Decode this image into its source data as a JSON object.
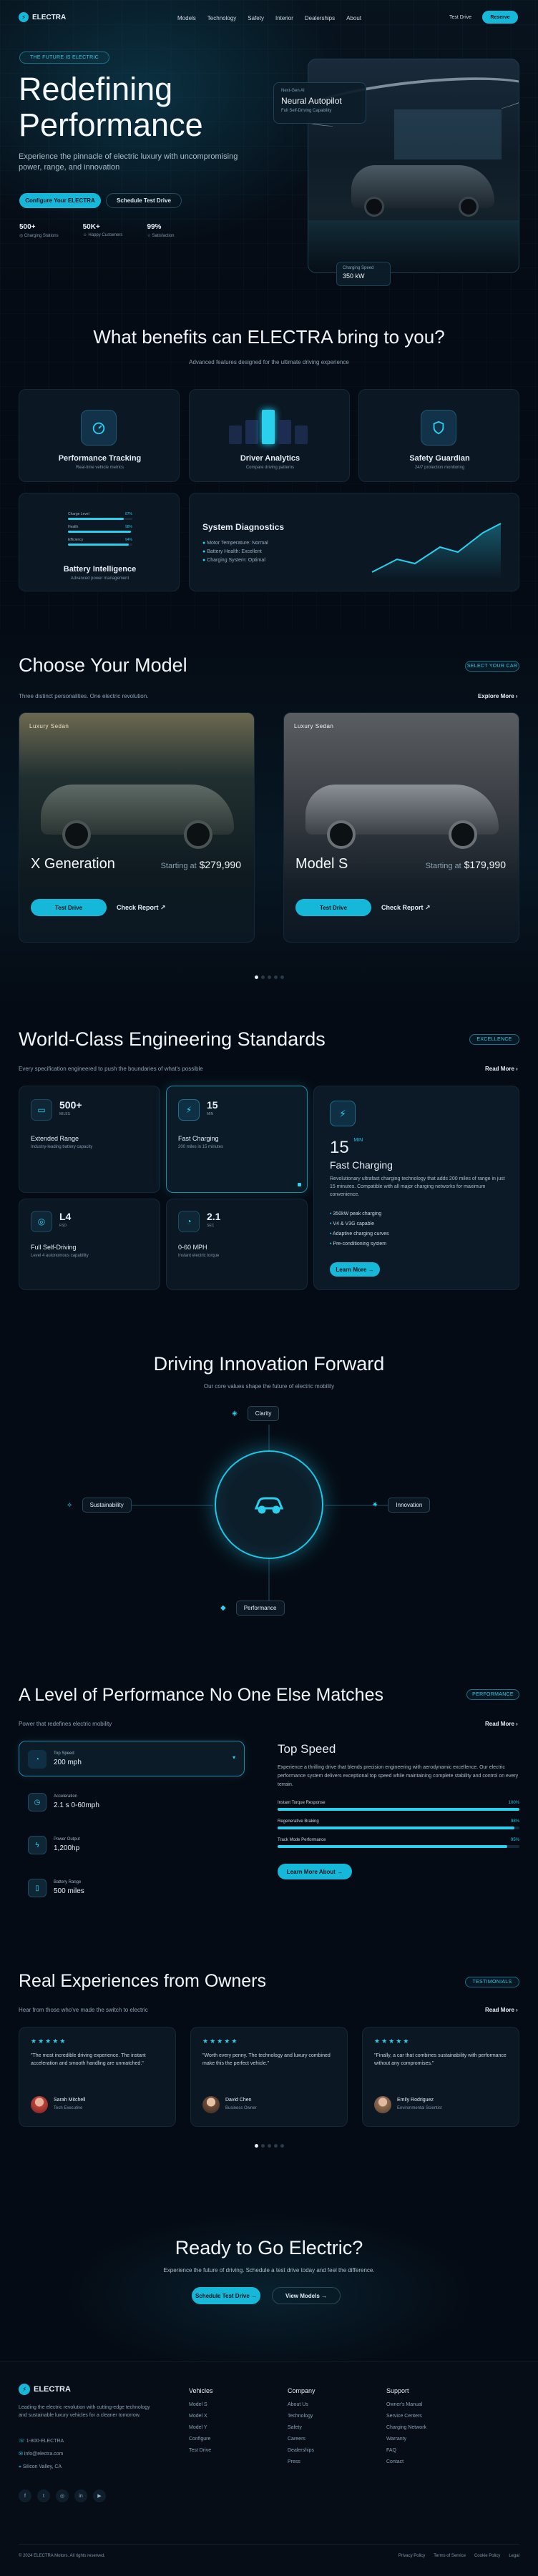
{
  "nav": {
    "brand": "ELECTRA",
    "links": [
      "Models",
      "Technology",
      "Safety",
      "Interior",
      "Dealerships",
      "About"
    ],
    "test_drive": "Test Drive",
    "reserve": "Reserve"
  },
  "hero": {
    "tag": "THE FUTURE IS ELECTRIC",
    "title1": "Redefining",
    "title2": "Performance",
    "desc": "Experience the pinnacle of electric luxury with uncompromising power, range, and innovation",
    "cta_primary": "Configure Your ELECTRA",
    "cta_secondary": "Schedule Test Drive",
    "stats": [
      {
        "value": "500+",
        "label": "Charging Stations"
      },
      {
        "value": "50K+",
        "label": "Happy Customers"
      },
      {
        "value": "99%",
        "label": "Satisfaction"
      }
    ],
    "card_small": "Next-Gen AI",
    "card_title": "Neural Autopilot",
    "card_desc": "Full Self-Driving Capability",
    "charge_label": "Charging Speed",
    "charge_value": "350 kW"
  },
  "benefits": {
    "title": "What benefits can ELECTRA bring to you?",
    "subtitle": "Advanced features designed for the ultimate driving experience",
    "cards": [
      {
        "title": "Performance Tracking",
        "desc": "Real-time vehicle metrics"
      },
      {
        "title": "Driver Analytics",
        "desc": "Compare driving patterns"
      },
      {
        "title": "Safety Guardian",
        "desc": "24/7 protection monitoring"
      }
    ],
    "battery": {
      "title": "Battery Intelligence",
      "desc": "Advanced power management",
      "bars": [
        {
          "label": "Charge Level",
          "value": "87%",
          "pct": 87
        },
        {
          "label": "Health",
          "value": "98%",
          "pct": 98
        },
        {
          "label": "Efficiency",
          "value": "94%",
          "pct": 94
        }
      ]
    },
    "diag": {
      "title": "System Diagnostics",
      "items": [
        "Motor Temperature: Normal",
        "Battery Health: Excellent",
        "Charging System: Optimal"
      ]
    }
  },
  "models": {
    "title": "Choose Your Model",
    "subtitle": "Three distinct personalities. One electric revolution.",
    "pill": "SELECT YOUR CAR",
    "explore": "Explore More",
    "cards": [
      {
        "badge": "Luxury Sedan",
        "name": "X Generation",
        "starting": "Starting at",
        "price": "$279,990",
        "test": "Test Drive",
        "report": "Check Report"
      },
      {
        "badge": "Luxury Sedan",
        "name": "Model S",
        "starting": "Starting at",
        "price": "$179,990",
        "test": "Test Drive",
        "report": "Check Report"
      }
    ]
  },
  "engineering": {
    "title": "World-Class Engineering Standards",
    "subtitle": "Every specification engineered to push the boundaries of what's possible",
    "pill": "EXCELLENCE",
    "read_more": "Read More",
    "cards": [
      {
        "value": "500+",
        "unit": "MILES",
        "title": "Extended Range",
        "desc": "Industry-leading battery capacity"
      },
      {
        "value": "15",
        "unit": "MIN",
        "title": "Fast Charging",
        "desc": "200 miles in 15 minutes"
      },
      {
        "value": "L4",
        "unit": "FSD",
        "title": "Full Self-Driving",
        "desc": "Level 4 autonomous capability"
      },
      {
        "value": "2.1",
        "unit": "SEC",
        "title": "0-60 MPH",
        "desc": "Instant electric torque"
      }
    ],
    "detail": {
      "value": "15",
      "unit": "MIN",
      "title": "Fast Charging",
      "desc": "Revolutionary ultrafast charging technology that adds 200 miles of range in just 15 minutes. Compatible with all major charging networks for maximum convenience.",
      "features": [
        "350kW peak charging",
        "V4 & V3G capable",
        "Adaptive charging curves",
        "Pre-conditioning system"
      ],
      "cta": "Learn More"
    }
  },
  "innovation": {
    "title": "Driving Innovation Forward",
    "subtitle": "Our core values shape the future of electric mobility",
    "nodes": [
      "Clarity",
      "Sustainability",
      "Innovation",
      "Performance"
    ]
  },
  "performance": {
    "title": "A Level of Performance No One Else Matches",
    "subtitle": "Power that redefines electric mobility",
    "pill": "PERFORMANCE",
    "read_more": "Read More",
    "list": [
      {
        "label": "Top Speed",
        "value": "200 mph"
      },
      {
        "label": "Acceleration",
        "value": "2.1 s 0-60mph"
      },
      {
        "label": "Power Output",
        "value": "1,200hp"
      },
      {
        "label": "Battery Range",
        "value": "500 miles"
      }
    ],
    "detail": {
      "title": "Top Speed",
      "desc": "Experience a thrilling drive that blends precision engineering with aerodynamic excellence. Our electric performance system delivers exceptional top speed while maintaining complete stability and control on every terrain.",
      "bars": [
        {
          "label": "Instant Torque Response",
          "value": "100%",
          "pct": 100
        },
        {
          "label": "Regenerative Braking",
          "value": "98%",
          "pct": 98
        },
        {
          "label": "Track Mode Performance",
          "value": "95%",
          "pct": 95
        }
      ],
      "cta": "Learn More About"
    }
  },
  "testimonials": {
    "title": "Real Experiences from Owners",
    "subtitle": "Hear from those who've made the switch to electric",
    "pill": "TESTIMONIALS",
    "items": [
      {
        "quote": "\"The most incredible driving experience. The instant acceleration and smooth handling are unmatched.\"",
        "name": "Sarah Mitchell",
        "role": "Tech Executive"
      },
      {
        "quote": "\"Worth every penny. The technology and luxury combined make this the perfect vehicle.\"",
        "name": "David Chen",
        "role": "Business Owner"
      },
      {
        "quote": "\"Finally, a car that combines sustainability with performance without any compromises.\"",
        "name": "Emily Rodriguez",
        "role": "Environmental Scientist"
      }
    ]
  },
  "cta": {
    "title": "Ready to Go Electric?",
    "desc": "Experience the future of driving. Schedule a test drive today and feel the difference.",
    "primary": "Schedule Test Drive",
    "secondary": "View Models"
  },
  "footer": {
    "brand": "ELECTRA",
    "about": "Leading the electric revolution with cutting-edge technology and sustainable luxury vehicles for a cleaner tomorrow.",
    "phone": "1-800-ELECTRA",
    "email": "info@electra.com",
    "location": "Silicon Valley, CA",
    "cols": [
      {
        "title": "Vehicles",
        "links": [
          "Model S",
          "Model X",
          "Model Y",
          "Configure",
          "Test Drive"
        ]
      },
      {
        "title": "Company",
        "links": [
          "About Us",
          "Technology",
          "Safety",
          "Careers",
          "Dealerships",
          "Press"
        ]
      },
      {
        "title": "Support",
        "links": [
          "Owner's Manual",
          "Service Centers",
          "Charging Network",
          "Warranty",
          "FAQ",
          "Contact"
        ]
      }
    ],
    "copyright": "© 2024 ELECTRA Motors. All rights reserved.",
    "legal": [
      "Privacy Policy",
      "Terms of Service",
      "Cookie Policy",
      "Legal"
    ]
  },
  "colors": {
    "accent": "#15b8d8",
    "bg": "#050b14",
    "card": "#0b1723"
  }
}
